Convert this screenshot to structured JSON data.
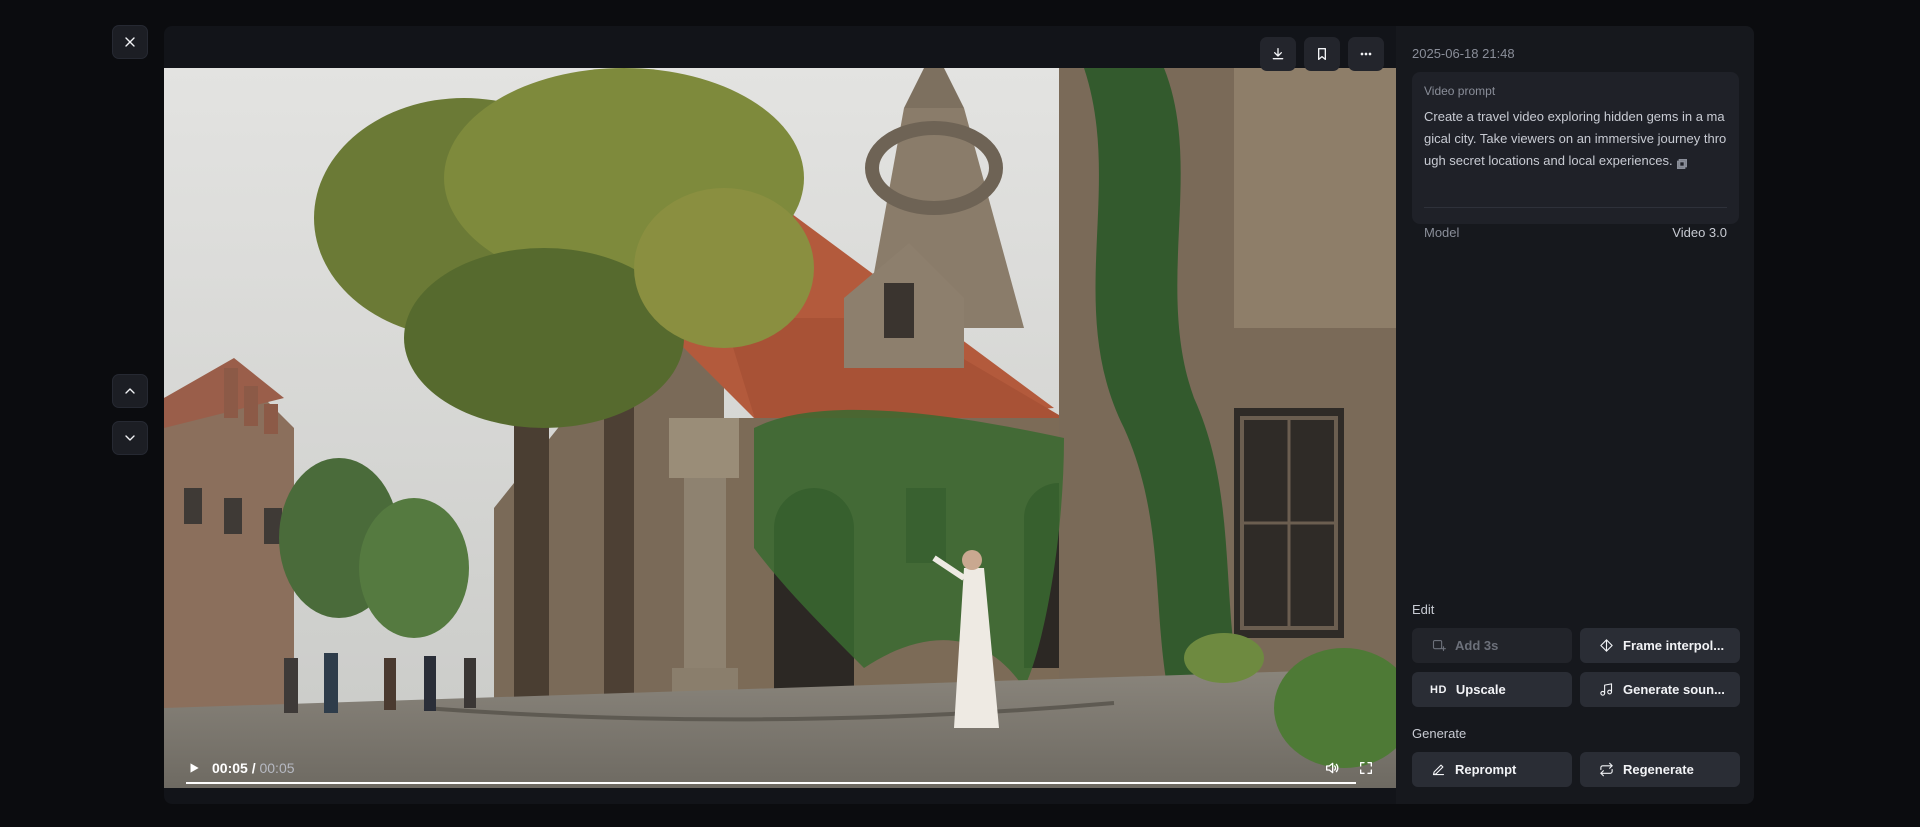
{
  "nav": {
    "close_icon": "close-icon",
    "prev_icon": "chevron-up-icon",
    "next_icon": "chevron-down-icon"
  },
  "toolbar": {
    "download_icon": "download-icon",
    "bookmark_icon": "bookmark-icon",
    "more_icon": "more-icon"
  },
  "player": {
    "current_time": "00:05",
    "separator": " / ",
    "duration": "00:05",
    "progress": 1.0,
    "play_icon": "play-icon",
    "volume_icon": "volume-icon",
    "fullscreen_icon": "fullscreen-icon"
  },
  "details": {
    "timestamp": "2025-06-18 21:48",
    "prompt_label": "Video prompt",
    "prompt_text": "Create a travel video exploring hidden gems in a magical city. Take viewers on an immersive journey through secret locations and local experiences.",
    "model_label": "Model",
    "model_value": "Video 3.0"
  },
  "edit": {
    "label": "Edit",
    "add3s": "Add 3s",
    "frame_interpolation": "Frame interpol...",
    "upscale_badge": "HD",
    "upscale": "Upscale",
    "generate_sound": "Generate soun..."
  },
  "generate": {
    "label": "Generate",
    "reprompt": "Reprompt",
    "regenerate": "Regenerate"
  },
  "colors": {
    "background": "#0b0c0f",
    "panel": "#16181d",
    "button": "#2a2d35"
  }
}
